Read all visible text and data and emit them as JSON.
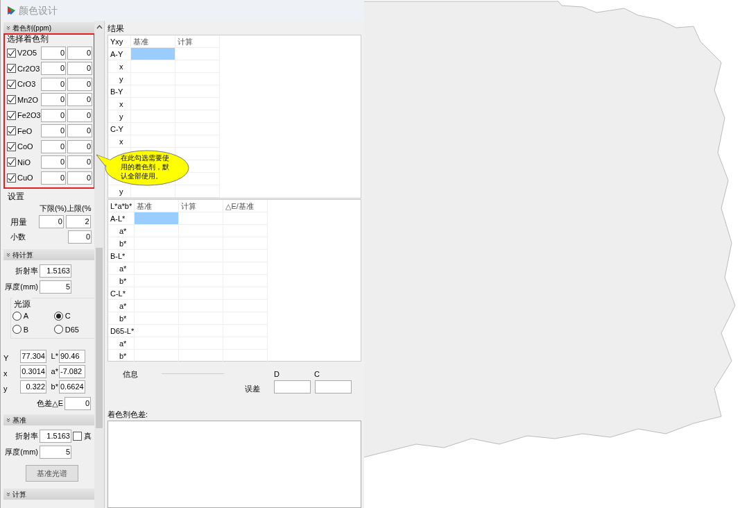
{
  "window": {
    "title": "颜色设计"
  },
  "colorants": {
    "header": "着色剂(ppm)",
    "label": "选择着色剂",
    "items": [
      {
        "name": "V2O5",
        "checked": true,
        "low": "0",
        "high": "0"
      },
      {
        "name": "Cr2O3",
        "checked": true,
        "low": "0",
        "high": "0"
      },
      {
        "name": "CrO3",
        "checked": true,
        "low": "0",
        "high": "0"
      },
      {
        "name": "Mn2O",
        "checked": true,
        "low": "0",
        "high": "0"
      },
      {
        "name": "Fe2O3",
        "checked": true,
        "low": "0",
        "high": "0"
      },
      {
        "name": "FeO",
        "checked": true,
        "low": "0",
        "high": "0"
      },
      {
        "name": "CoO",
        "checked": true,
        "low": "0",
        "high": "0"
      },
      {
        "name": "NiO",
        "checked": true,
        "low": "0",
        "high": "0"
      },
      {
        "name": "CuO",
        "checked": true,
        "low": "0",
        "high": "0"
      }
    ]
  },
  "settings": {
    "label": "设置",
    "col_low": "下限(%)",
    "col_high": "上限(%",
    "dosage_label": "用量",
    "dosage_low": "0",
    "dosage_high": "2",
    "decimals_label": "小数",
    "decimals": "0"
  },
  "pending": {
    "header": "待计算",
    "refractive_label": "折射率",
    "refractive": "1.5163",
    "thickness_label": "厚度(mm)",
    "thickness": "5",
    "illuminant_label": "光源",
    "illuminants": [
      {
        "label": "A",
        "selected": false
      },
      {
        "label": "C",
        "selected": true
      },
      {
        "label": "B",
        "selected": false
      },
      {
        "label": "D65",
        "selected": false
      }
    ],
    "readings": [
      {
        "label": "Y",
        "value": "77.304",
        "label2": "L*",
        "value2": "90.46"
      },
      {
        "label": "x",
        "value": "0.3014",
        "label2": "a*",
        "value2": "-7.082"
      },
      {
        "label": "y",
        "value": "0.322",
        "label2": "b*",
        "value2": "0.6624"
      }
    ],
    "delta_label": "色差△E",
    "delta": "0"
  },
  "reference": {
    "header": "基准",
    "refractive_label": "折射率",
    "refractive": "1.5163",
    "vacuum_label": "真",
    "vacuum_checked": false,
    "thickness_label": "厚度(mm)",
    "thickness": "5",
    "button": "基准光谱"
  },
  "calc": {
    "header": "计算"
  },
  "results": {
    "label": "结果",
    "yxy": {
      "columns": [
        "Yxy",
        "基准",
        "计算"
      ],
      "rows": [
        {
          "label": "A-Y",
          "selected": true
        },
        {
          "label": "x",
          "selected": false
        },
        {
          "label": "y",
          "selected": false
        },
        {
          "label": "B-Y",
          "selected": false
        },
        {
          "label": "x",
          "selected": false
        },
        {
          "label": "y",
          "selected": false
        },
        {
          "label": "C-Y",
          "selected": false
        },
        {
          "label": "x",
          "selected": false
        },
        {},
        {},
        {},
        {
          "label": "y",
          "selected": false
        }
      ]
    },
    "lab": {
      "columns": [
        "L*a*b*",
        "基准",
        "计算",
        "△E/基准"
      ],
      "rows": [
        {
          "label": "A-L*",
          "selected": true
        },
        {
          "label": "a*",
          "selected": false
        },
        {
          "label": "b*",
          "selected": false
        },
        {
          "label": "B-L*",
          "selected": false
        },
        {
          "label": "a*",
          "selected": false
        },
        {
          "label": "b*",
          "selected": false
        },
        {
          "label": "C-L*",
          "selected": false
        },
        {
          "label": "a*",
          "selected": false
        },
        {
          "label": "b*",
          "selected": false
        },
        {
          "label": "D65-L*",
          "selected": false
        },
        {
          "label": "a*",
          "selected": false
        },
        {
          "label": "b*",
          "selected": false
        }
      ]
    }
  },
  "info": {
    "label": "信息",
    "col_d": "D",
    "col_c": "C",
    "error_label": "误差",
    "diff_label": "着色剂色差:"
  },
  "callout": {
    "text": "在此勾选需要使用的着色剂，默认全部使用。"
  }
}
